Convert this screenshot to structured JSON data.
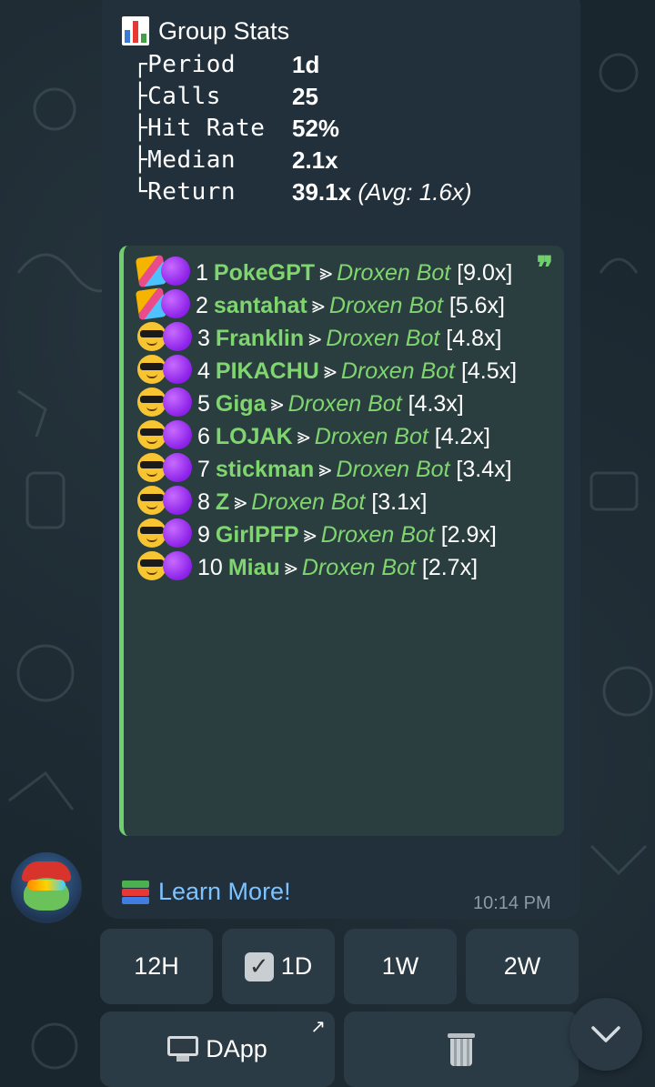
{
  "stats": {
    "title": "Group Stats",
    "rows": [
      {
        "label": "┌Period",
        "value": "1d",
        "extra": ""
      },
      {
        "label": "├Calls",
        "value": "25",
        "extra": ""
      },
      {
        "label": "├Hit Rate",
        "value": "52%",
        "extra": ""
      },
      {
        "label": "├Median",
        "value": "2.1x",
        "extra": ""
      },
      {
        "label": "└Return",
        "value": "39.1x",
        "extra": "(Avg: 1.6x)"
      }
    ]
  },
  "leaderboard": {
    "quote_mark": "❞",
    "separator": "⪢",
    "entries": [
      {
        "emoji": "party",
        "rank": "1",
        "name": "PokeGPT",
        "bot": "Droxen Bot",
        "mult": "[9.0x]"
      },
      {
        "emoji": "party",
        "rank": "2",
        "name": "santahat",
        "bot": "Droxen Bot",
        "mult": "[5.6x]"
      },
      {
        "emoji": "cool",
        "rank": "3",
        "name": "Franklin",
        "bot": "Droxen Bot",
        "mult": "[4.8x]"
      },
      {
        "emoji": "cool",
        "rank": "4",
        "name": "PIKACHU",
        "bot": "Droxen Bot",
        "mult": "[4.5x]"
      },
      {
        "emoji": "cool",
        "rank": "5",
        "name": "Giga",
        "bot": "Droxen Bot",
        "mult": "[4.3x]"
      },
      {
        "emoji": "cool",
        "rank": "6",
        "name": "LOJAK",
        "bot": "Droxen Bot",
        "mult": "[4.2x]"
      },
      {
        "emoji": "cool",
        "rank": "7",
        "name": "stickman",
        "bot": "Droxen Bot",
        "mult": "[3.4x]"
      },
      {
        "emoji": "cool",
        "rank": "8",
        "name": "Z",
        "bot": "Droxen Bot",
        "mult": "[3.1x]"
      },
      {
        "emoji": "cool",
        "rank": "9",
        "name": "GirlPFP",
        "bot": "Droxen Bot",
        "mult": "[2.9x]"
      },
      {
        "emoji": "cool",
        "rank": "10",
        "name": "Miau",
        "bot": "Droxen Bot",
        "mult": "[2.7x]"
      }
    ]
  },
  "learn_more": "Learn More!",
  "timestamp": "10:14 PM",
  "keyboard": {
    "periods": [
      "12H",
      "1D",
      "1W",
      "2W"
    ],
    "selected_period": "1D",
    "dapp_label": "DApp",
    "delete_icon": "trash-icon"
  },
  "colors": {
    "accent_green": "#6fd16c",
    "link_blue": "#7ec3ff",
    "bubble": "#21303b"
  }
}
